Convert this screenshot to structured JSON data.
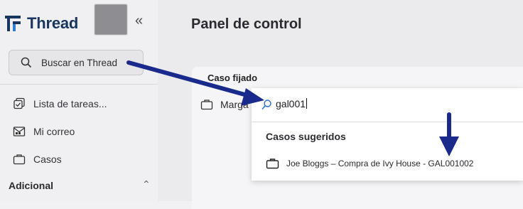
{
  "app": {
    "name": "Thread",
    "brand_color": "#17355e"
  },
  "sidebar": {
    "search_label": "Buscar en Thread",
    "collapse_glyph": "«",
    "items": [
      {
        "label": "Lista de tareas...",
        "icon": "tasks-icon"
      },
      {
        "label": "Mi correo",
        "icon": "mail-icon"
      },
      {
        "label": "Casos",
        "icon": "briefcase-icon"
      }
    ],
    "section": {
      "label": "Adicional",
      "caret": "⌃"
    }
  },
  "main": {
    "title": "Panel de control",
    "pinned": {
      "label": "Caso fijado",
      "item_label": "Marga"
    }
  },
  "dropdown": {
    "query": "gal001",
    "heading": "Casos sugeridos",
    "results": [
      {
        "label": "Joe Bloggs – Compra de Ivy House - GAL001002",
        "icon": "briefcase-icon"
      }
    ]
  },
  "annotations": {
    "arrow_color": "#1a2a8c"
  }
}
